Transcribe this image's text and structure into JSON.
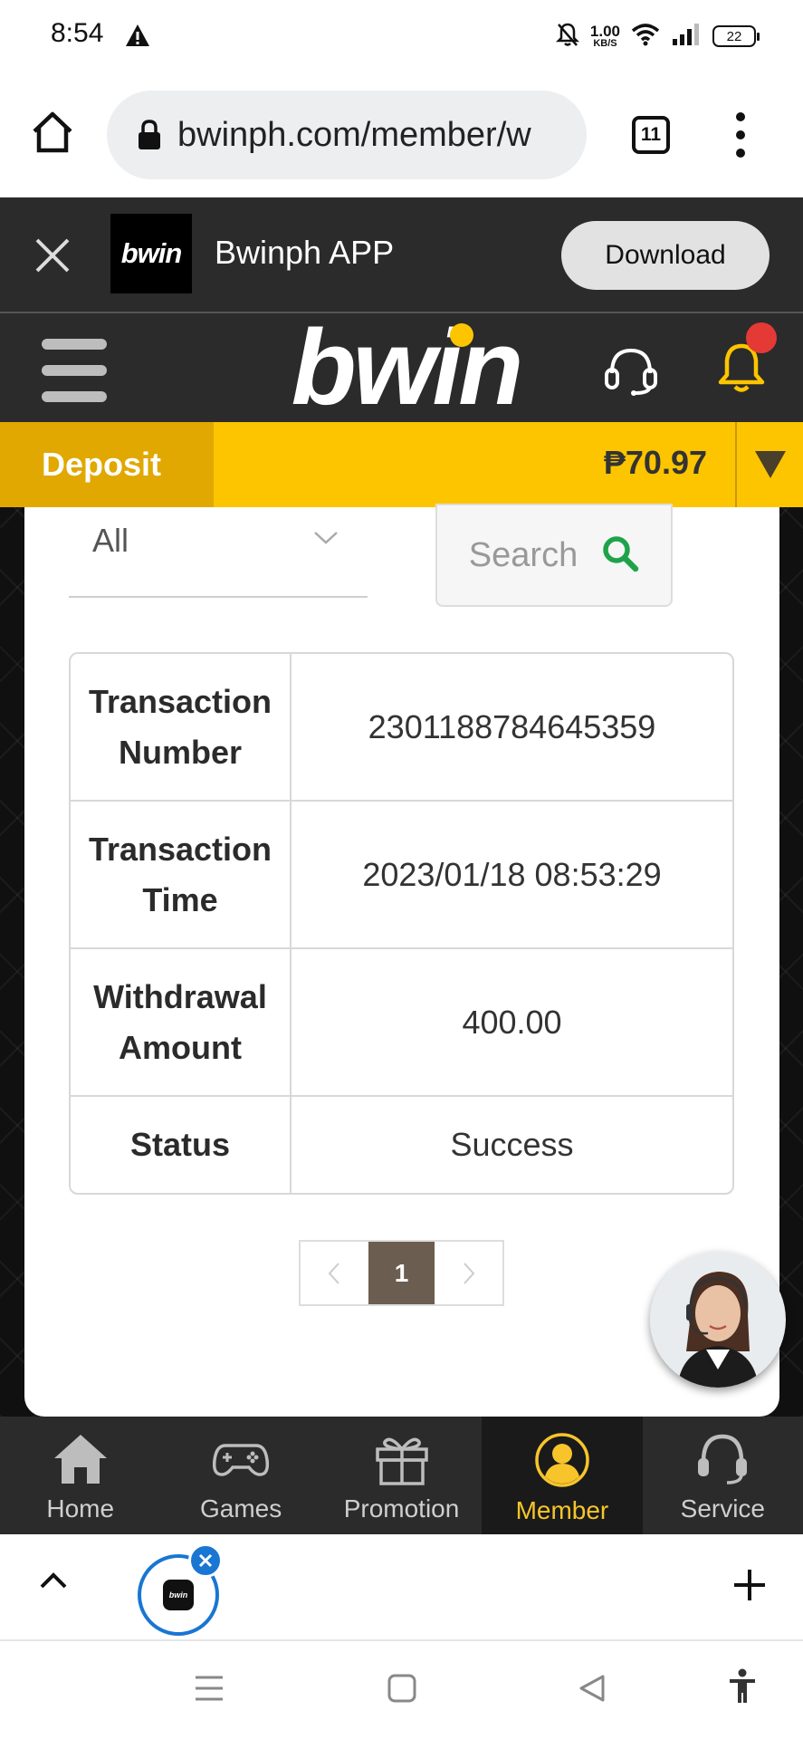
{
  "status_bar": {
    "time": "8:54",
    "net_speed_value": "1.00",
    "net_speed_unit": "KB/S",
    "battery": "22"
  },
  "browser": {
    "url": "bwinph.com/member/w",
    "tab_count": "11"
  },
  "app_banner": {
    "logo_text": "bwin",
    "title": "Bwinph APP",
    "download_label": "Download"
  },
  "header": {
    "brand": "bwin"
  },
  "account_bar": {
    "deposit_label": "Deposit",
    "balance": "₱70.97"
  },
  "filter": {
    "selected": "All",
    "search_label": "Search"
  },
  "details": [
    {
      "label_line1": "Transaction",
      "label_line2": "Number",
      "value": "2301188784645359"
    },
    {
      "label_line1": "Transaction",
      "label_line2": "Time",
      "value": "2023/01/18 08:53:29"
    },
    {
      "label_line1": "Withdrawal",
      "label_line2": "Amount",
      "value": "400.00"
    },
    {
      "label_line1": "Status",
      "label_line2": "",
      "value": "Success"
    }
  ],
  "pagination": {
    "current_page": "1"
  },
  "bottom_nav": {
    "items": [
      {
        "label": "Home",
        "icon": "home-icon"
      },
      {
        "label": "Games",
        "icon": "gamepad-icon"
      },
      {
        "label": "Promotion",
        "icon": "gift-icon"
      },
      {
        "label": "Member",
        "icon": "member-icon",
        "active": true
      },
      {
        "label": "Service",
        "icon": "headset-icon"
      }
    ]
  },
  "tab_strip": {
    "favicon_text": "bwin"
  },
  "colors": {
    "accent_yellow": "#fdc500",
    "deposit_yellow": "#e0a800",
    "dark_header": "#2b2b2b",
    "active_nav": "#f7c52b",
    "search_green": "#1ea34a",
    "page_active": "#6b5e50",
    "notification_red": "#e53935"
  }
}
